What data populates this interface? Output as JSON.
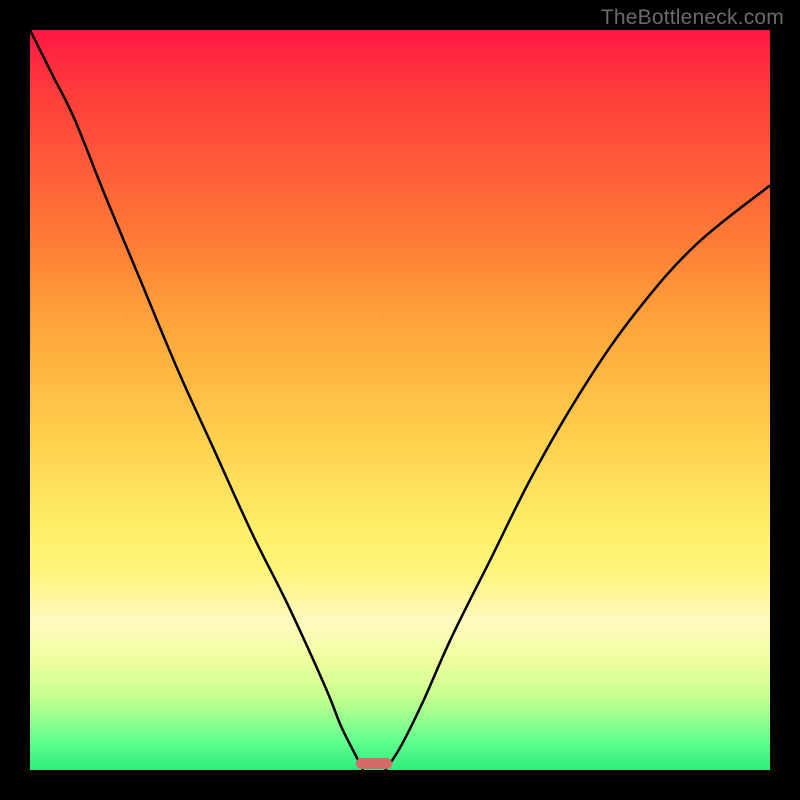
{
  "watermark": "TheBottleneck.com",
  "chart_data": {
    "type": "line",
    "title": "",
    "xlabel": "",
    "ylabel": "",
    "xlim": [
      0,
      100
    ],
    "ylim": [
      0,
      100
    ],
    "grid": false,
    "legend": false,
    "background_gradient": {
      "stops": [
        {
          "pos": 0,
          "color": "#ff1744"
        },
        {
          "pos": 18,
          "color": "#ff5a3a"
        },
        {
          "pos": 40,
          "color": "#ffa53a"
        },
        {
          "pos": 68,
          "color": "#fff06a"
        },
        {
          "pos": 85,
          "color": "#f0ff9e"
        },
        {
          "pos": 100,
          "color": "#2fec7c"
        }
      ]
    },
    "series": [
      {
        "name": "left-curve",
        "x": [
          0,
          3,
          6,
          10,
          15,
          20,
          25,
          30,
          35,
          40,
          42,
          44,
          45
        ],
        "y": [
          100,
          94,
          88,
          78,
          66,
          54,
          43,
          32,
          22,
          11,
          6,
          2,
          0
        ]
      },
      {
        "name": "right-curve",
        "x": [
          48,
          50,
          53,
          57,
          62,
          68,
          75,
          82,
          90,
          100
        ],
        "y": [
          0,
          3,
          9,
          18,
          28,
          40,
          52,
          62,
          71,
          79
        ]
      }
    ],
    "marker": {
      "x": 46.5,
      "y": 0,
      "color": "#d46a6a"
    }
  }
}
